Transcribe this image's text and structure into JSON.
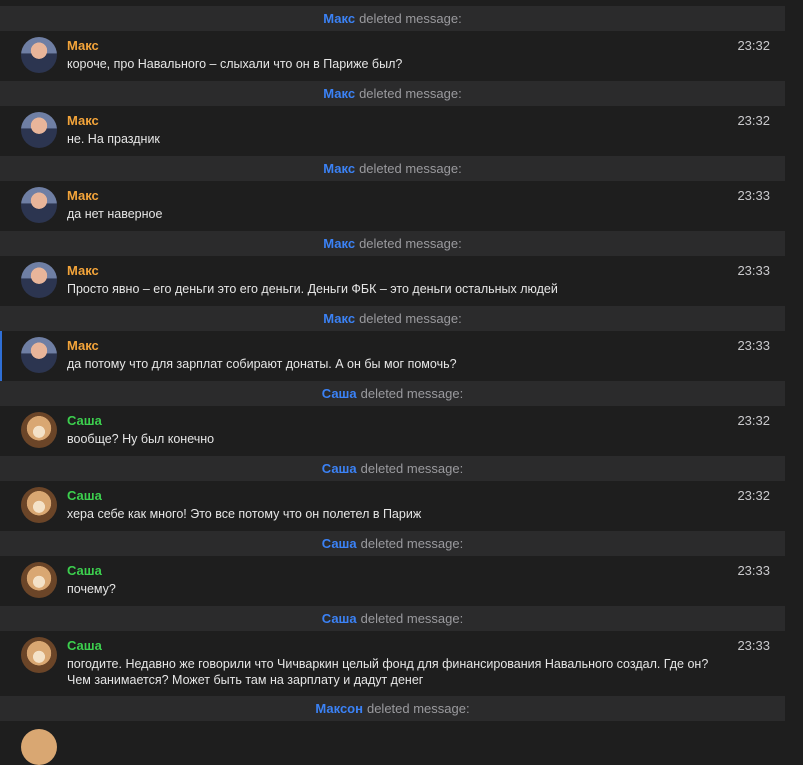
{
  "messages_area": {
    "items": [
      {
        "type": "system",
        "who": "Макс",
        "text": "deleted message:"
      },
      {
        "type": "msg",
        "author": "Макс",
        "kind": "maks",
        "time": "23:32",
        "text": "короче, про Навального – слыхали что он в Париже был?"
      },
      {
        "type": "system",
        "who": "Макс",
        "text": "deleted message:"
      },
      {
        "type": "msg",
        "author": "Макс",
        "kind": "maks",
        "time": "23:32",
        "text": "не. На праздник"
      },
      {
        "type": "system",
        "who": "Макс",
        "text": "deleted message:"
      },
      {
        "type": "msg",
        "author": "Макс",
        "kind": "maks",
        "time": "23:33",
        "text": "да нет наверное"
      },
      {
        "type": "system",
        "who": "Макс",
        "text": "deleted message:"
      },
      {
        "type": "msg",
        "author": "Макс",
        "kind": "maks",
        "time": "23:33",
        "text": "Просто явно – его деньги это его деньги. Деньги ФБК – это деньги остальных людей"
      },
      {
        "type": "system",
        "who": "Макс",
        "text": "deleted message:"
      },
      {
        "type": "msg",
        "author": "Макс",
        "kind": "maks",
        "time": "23:33",
        "text": "да потому что для зарплат собирают донаты. А он бы мог помочь?",
        "highlight": true
      },
      {
        "type": "system",
        "who": "Саша",
        "text": "deleted message:"
      },
      {
        "type": "msg",
        "author": "Саша",
        "kind": "sasha",
        "time": "23:32",
        "text": "вообще? Ну был конечно"
      },
      {
        "type": "system",
        "who": "Саша",
        "text": "deleted message:"
      },
      {
        "type": "msg",
        "author": "Саша",
        "kind": "sasha",
        "time": "23:32",
        "text": "хера себе как много! Это все потому что он полетел в Париж"
      },
      {
        "type": "system",
        "who": "Саша",
        "text": "deleted message:"
      },
      {
        "type": "msg",
        "author": "Саша",
        "kind": "sasha",
        "time": "23:33",
        "text": "почему?"
      },
      {
        "type": "system",
        "who": "Саша",
        "text": "deleted message:"
      },
      {
        "type": "msg",
        "author": "Саша",
        "kind": "sasha",
        "time": "23:33",
        "text": "погодите. Недавно же говорили что Чичваркин целый фонд для финансирования Навального создал. Где он? Чем занимается? Может быть там на зарплату и дадут денег",
        "tall": true
      },
      {
        "type": "system",
        "who": "Максон",
        "text": "deleted message:"
      }
    ]
  },
  "colors": {
    "background": "#1e1e1e",
    "system_bar": "#2b2b2c",
    "system_name": "#3b82f6",
    "maks_name": "#f3a43a",
    "sasha_name": "#3ccf4e"
  }
}
